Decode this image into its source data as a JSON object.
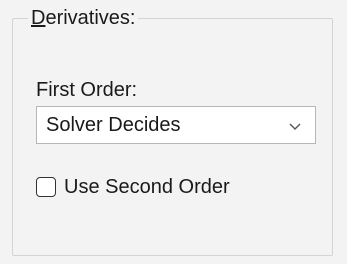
{
  "derivatives": {
    "group_title_mnemonic": "D",
    "group_title_rest": "erivatives:",
    "first_order_label": "First Order:",
    "first_order_value": "Solver Decides",
    "second_order_label": "Use Second Order",
    "second_order_checked": false
  },
  "icons": {
    "dropdown": "chevron-down-icon"
  }
}
